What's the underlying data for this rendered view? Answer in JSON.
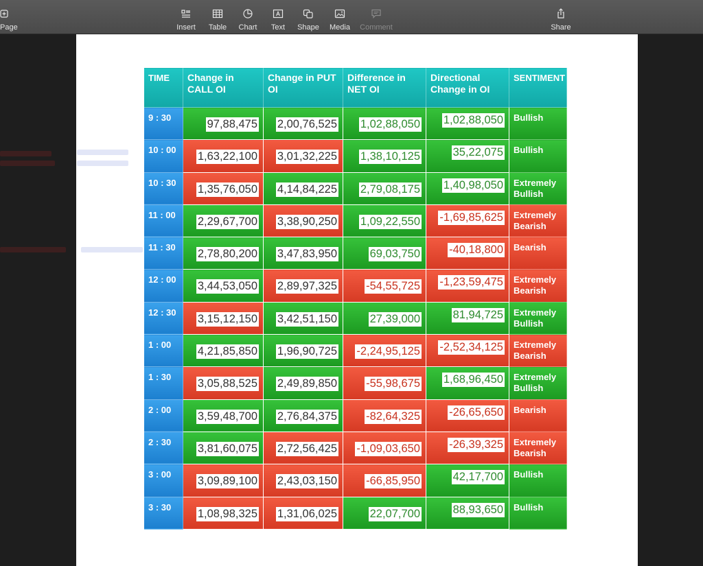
{
  "toolbar": {
    "page": "Page",
    "items": [
      {
        "label": "Insert",
        "icon": "insert-icon"
      },
      {
        "label": "Table",
        "icon": "table-icon"
      },
      {
        "label": "Chart",
        "icon": "chart-icon"
      },
      {
        "label": "Text",
        "icon": "text-icon"
      },
      {
        "label": "Shape",
        "icon": "shape-icon"
      },
      {
        "label": "Media",
        "icon": "media-icon"
      },
      {
        "label": "Comment",
        "icon": "comment-icon"
      }
    ],
    "share": "Share"
  },
  "table": {
    "headers": [
      "TIME",
      "Change in CALL OI",
      "Change in PUT OI",
      "Difference in NET OI",
      "Directional Change in OI",
      "SENTIMENT"
    ],
    "rows": [
      {
        "time": "9 : 30",
        "call": "97,88,475",
        "put": "2,00,76,525",
        "net": "1,02,88,050",
        "dir": "1,02,88,050",
        "sentiment": "Bullish"
      },
      {
        "time": "10 : 00",
        "call": "1,63,22,100",
        "put": "3,01,32,225",
        "net": "1,38,10,125",
        "dir": "35,22,075",
        "sentiment": "Bullish"
      },
      {
        "time": "10 : 30",
        "call": "1,35,76,050",
        "put": "4,14,84,225",
        "net": "2,79,08,175",
        "dir": "1,40,98,050",
        "sentiment": "Extremely Bullish"
      },
      {
        "time": "11 : 00",
        "call": "2,29,67,700",
        "put": "3,38,90,250",
        "net": "1,09,22,550",
        "dir": "-1,69,85,625",
        "sentiment": "Extremely Bearish"
      },
      {
        "time": "11 : 30",
        "call": "2,78,80,200",
        "put": "3,47,83,950",
        "net": "69,03,750",
        "dir": "-40,18,800",
        "sentiment": "Bearish"
      },
      {
        "time": "12 : 00",
        "call": "3,44,53,050",
        "put": "2,89,97,325",
        "net": "-54,55,725",
        "dir": "-1,23,59,475",
        "sentiment": "Extremely Bearish"
      },
      {
        "time": "12 : 30",
        "call": "3,15,12,150",
        "put": "3,42,51,150",
        "net": "27,39,000",
        "dir": "81,94,725",
        "sentiment": "Extremely Bullish"
      },
      {
        "time": "1 : 00",
        "call": "4,21,85,850",
        "put": "1,96,90,725",
        "net": "-2,24,95,125",
        "dir": "-2,52,34,125",
        "sentiment": "Extremely Bearish"
      },
      {
        "time": "1 : 30",
        "call": "3,05,88,525",
        "put": "2,49,89,850",
        "net": "-55,98,675",
        "dir": "1,68,96,450",
        "sentiment": "Extremely Bullish"
      },
      {
        "time": "2 : 00",
        "call": "3,59,48,700",
        "put": "2,76,84,375",
        "net": "-82,64,325",
        "dir": "-26,65,650",
        "sentiment": "Bearish"
      },
      {
        "time": "2 : 30",
        "call": "3,81,60,075",
        "put": "2,72,56,425",
        "net": "-1,09,03,650",
        "dir": "-26,39,325",
        "sentiment": "Extremely Bearish"
      },
      {
        "time": "3 : 00",
        "call": "3,09,89,100",
        "put": "2,43,03,150",
        "net": "-66,85,950",
        "dir": "42,17,700",
        "sentiment": "Bullish"
      },
      {
        "time": "3 : 30",
        "call": "1,08,98,325",
        "put": "1,31,06,025",
        "net": "22,07,700",
        "dir": "88,93,650",
        "sentiment": "Bullish"
      }
    ]
  },
  "colors": {
    "header": "#1fc7c4",
    "time": "#2a90e0",
    "green": "#2bb12f",
    "red": "#e64a30",
    "text_green": "#2e8b2e",
    "text_red": "#c8321e"
  }
}
